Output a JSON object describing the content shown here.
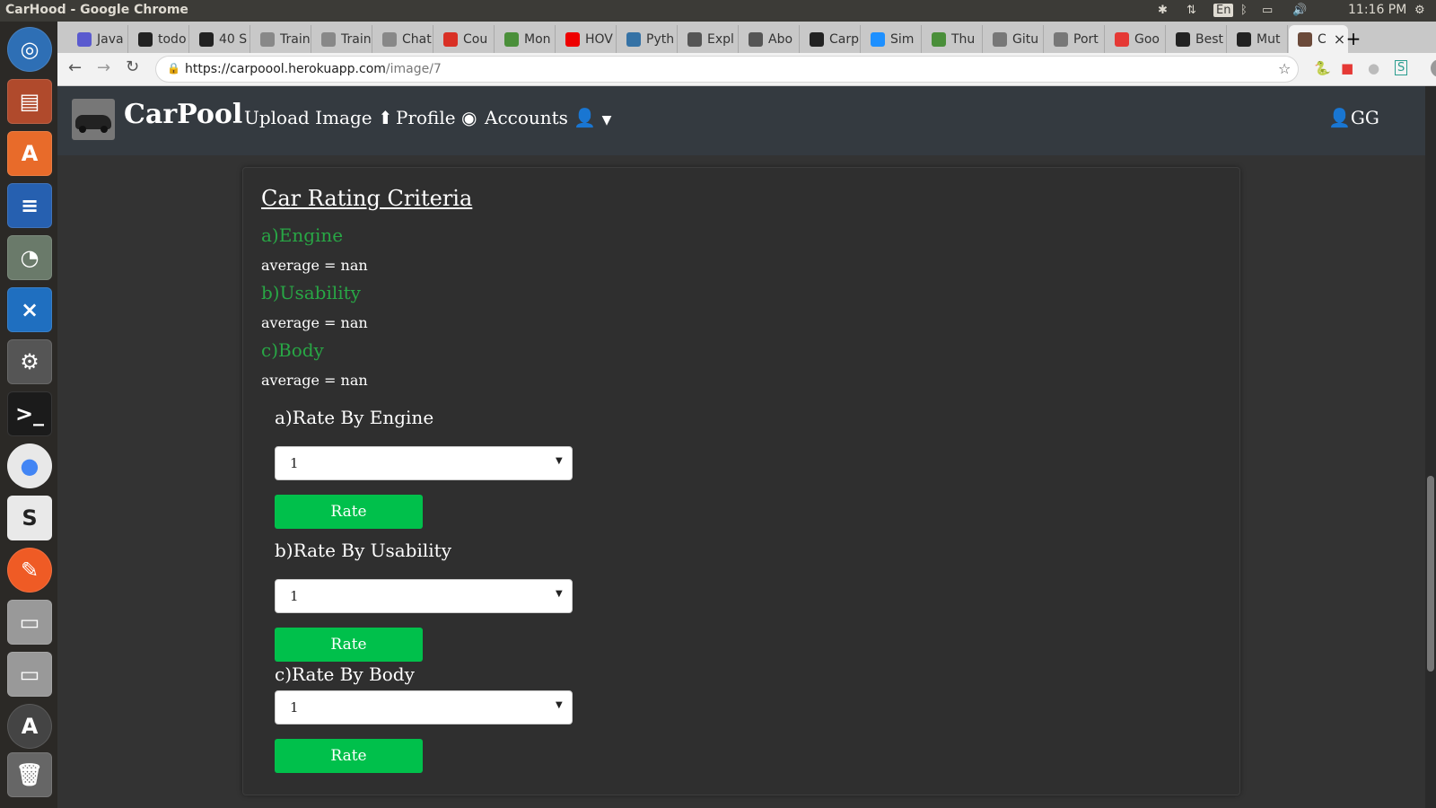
{
  "window": {
    "title": "CarHood - Google Chrome",
    "clock": "11:16 PM",
    "tray_lang": "En"
  },
  "tabs": [
    {
      "label": "Java",
      "color": "#5a5acf"
    },
    {
      "label": "todo",
      "color": "#222"
    },
    {
      "label": "40 S",
      "color": "#222"
    },
    {
      "label": "Train",
      "color": "#888"
    },
    {
      "label": "Train",
      "color": "#888"
    },
    {
      "label": "Chat",
      "color": "#888"
    },
    {
      "label": "Cou",
      "color": "#d93025"
    },
    {
      "label": "Mon",
      "color": "#4a8f3a"
    },
    {
      "label": "HOV",
      "color": "#e00"
    },
    {
      "label": "Pyth",
      "color": "#3572a5"
    },
    {
      "label": "Expl",
      "color": "#555"
    },
    {
      "label": "Abo",
      "color": "#555"
    },
    {
      "label": "Carp",
      "color": "#222"
    },
    {
      "label": "Sim",
      "color": "#1e90ff"
    },
    {
      "label": "Thu",
      "color": "#4a8f3a"
    },
    {
      "label": "Gitu",
      "color": "#777"
    },
    {
      "label": "Port",
      "color": "#777"
    },
    {
      "label": "Goo",
      "color": "#e53935"
    },
    {
      "label": "Best",
      "color": "#222"
    },
    {
      "label": "Mut",
      "color": "#222"
    },
    {
      "label": "C",
      "color": "#6b4a3a"
    }
  ],
  "url": {
    "host": "https://carpoool.herokuapp.com",
    "path": "/image/7"
  },
  "nav": {
    "brand": "CarPool",
    "upload": "Upload Image",
    "profile": "Profile",
    "accounts": "Accounts",
    "user": "GG"
  },
  "card": {
    "heading": "Car Rating Criteria",
    "criteria": [
      {
        "name": "a)Engine",
        "average": "average = nan"
      },
      {
        "name": "b)Usability",
        "average": "average = nan"
      },
      {
        "name": "c)Body",
        "average": "average = nan"
      }
    ],
    "forms": [
      {
        "label": "a)Rate By Engine",
        "value": "1",
        "button": "Rate"
      },
      {
        "label": "b)Rate By Usability",
        "value": "1",
        "button": "Rate"
      },
      {
        "label": "c)Rate By Body",
        "value": "1",
        "button": "Rate"
      }
    ]
  },
  "colors": {
    "accent_green": "#28a745",
    "button_green": "#00c04b",
    "navbar": "#343a40"
  }
}
